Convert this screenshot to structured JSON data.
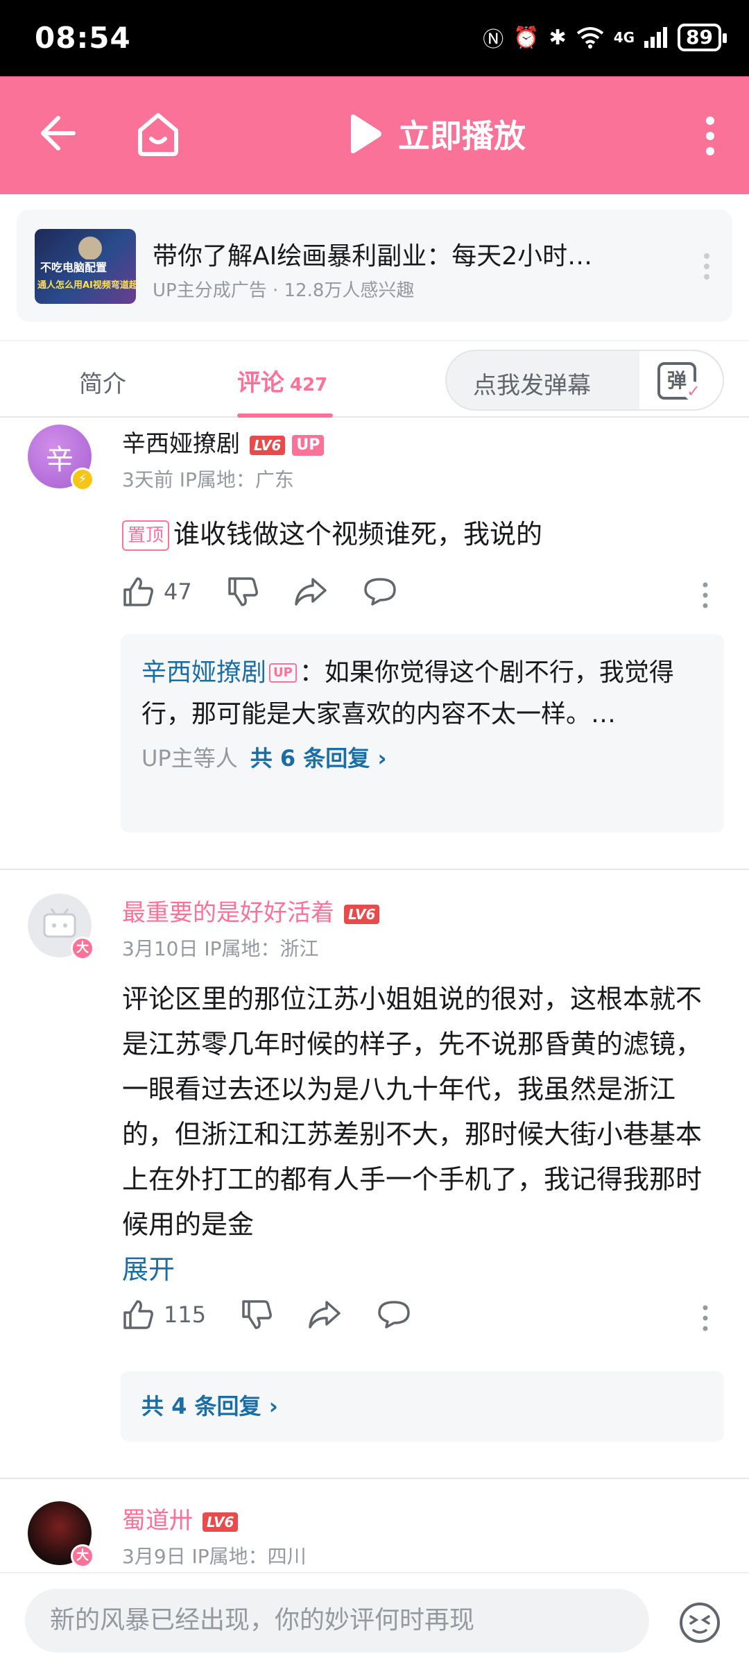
{
  "status_bar": {
    "time": "08:54",
    "network": "4G",
    "battery": "89"
  },
  "topbar": {
    "play_label": "立即播放"
  },
  "ad": {
    "title": "带你了解AI绘画暴利副业：每天2小时…",
    "subtitle": "UP主分成广告 · 12.8万人感兴趣",
    "thumb_line1": "不吃电脑配置",
    "thumb_line2": "通人怎么用AI视频弯道超"
  },
  "tabs": {
    "intro": "简介",
    "comments": "评论",
    "comments_count": "427",
    "danmaku_placeholder": "点我发弹幕",
    "danmaku_glyph": "弹"
  },
  "comments": [
    {
      "username": "辛西娅撩剧",
      "level": "LV6",
      "up_tag": "UP",
      "avatar_char": "辛",
      "meta": "3天前  IP属地：广东",
      "pin_label": "置顶",
      "text": "谁收钱做这个视频谁死，我说的",
      "likes": "47",
      "reply_author": "辛西娅撩剧",
      "reply_up_tag": "UP",
      "reply_text": "：如果你觉得这个剧不行，我觉得行，那可能是大家喜欢的内容不太一样。…",
      "reply_footer": "UP主等人",
      "reply_link": "共 6 条回复 ›"
    },
    {
      "username": "最重要的是好好活着",
      "level": "LV6",
      "avatar_badge": "大",
      "meta": "3月10日  IP属地：浙江",
      "text": "评论区里的那位江苏小姐姐说的很对，这根本就不是江苏零几年时候的样子，先不说那昏黄的滤镜，一眼看过去还以为是八九十年代，我虽然是浙江的，但浙江和江苏差别不大，那时候大街小巷基本上在外打工的都有人手一个手机了，我记得我那时候用的是金",
      "expand": "展开",
      "likes": "115",
      "reply_link": "共 4 条回复 ›"
    },
    {
      "username": "蜀道卅",
      "level": "LV6",
      "avatar_badge": "大",
      "meta": "3月9日  IP属地：四川"
    }
  ],
  "composer": {
    "placeholder": "新的风暴已经出现，你的妙评何时再现"
  },
  "colors": {
    "brand_pink": "#fb7299",
    "link_blue": "#1b6ea3",
    "meta_gray": "#9499a0"
  }
}
